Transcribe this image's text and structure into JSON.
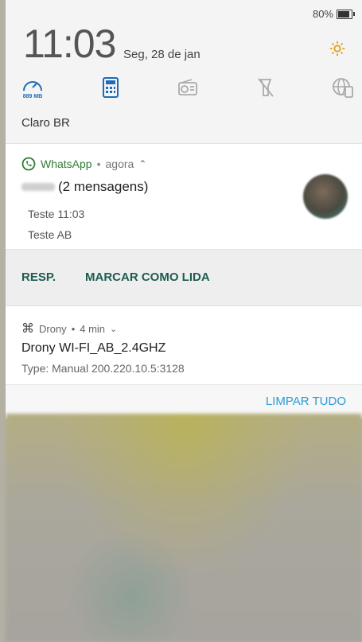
{
  "status": {
    "battery": "80%"
  },
  "quick_settings": {
    "time": "11:03",
    "date": "Seg, 28 de jan",
    "data_usage": "889 MB",
    "operator": "Claro BR",
    "tiles": [
      "data-speed-icon",
      "calculator-icon",
      "radio-icon",
      "flashlight-off-icon",
      "globe-phone-icon"
    ],
    "accent": "#e0a020"
  },
  "whatsapp": {
    "app": "WhatsApp",
    "sep": "•",
    "time": "agora",
    "title": "(2 mensagens)",
    "messages": [
      "Teste 11:03",
      "Teste AB"
    ],
    "actions": {
      "reply": "RESP.",
      "mark_read": "MARCAR COMO LIDA"
    },
    "color": "#2e7d32"
  },
  "drony": {
    "app": "Drony",
    "time": "4 min",
    "title": "Drony WI-FI_AB_2.4GHZ",
    "subtitle": "Type: Manual 200.220.10.5:3128"
  },
  "clear_all": "LIMPAR TUDO"
}
